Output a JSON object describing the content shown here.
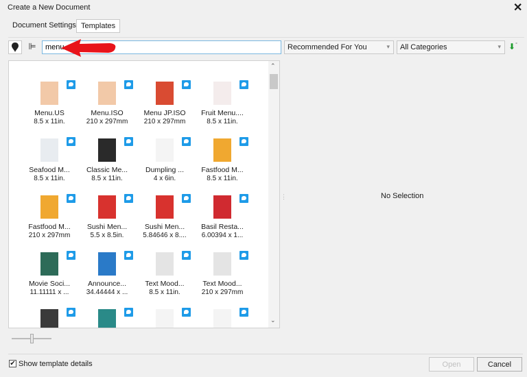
{
  "window": {
    "title": "Create a New Document",
    "close_icon": "close-icon"
  },
  "tabs": [
    {
      "label": "Document Settings"
    },
    {
      "label": "Templates",
      "active": true
    }
  ],
  "toolbar": {
    "search_value": "menu",
    "sort": "Recommended For You",
    "category": "All Categories"
  },
  "templates": [
    {
      "name": "Menu.US",
      "size": "8.5 x 11in.",
      "color": "#f2c9a8"
    },
    {
      "name": "Menu.ISO",
      "size": "210 x 297mm",
      "color": "#f2c9a8"
    },
    {
      "name": "Menu JP.ISO",
      "size": "210 x 297mm",
      "color": "#d94b32"
    },
    {
      "name": "Fruit Menu....",
      "size": "8.5 x 11in.",
      "color": "#f4ecec"
    },
    {
      "name": "Seafood M...",
      "size": "8.5 x 11in.",
      "color": "#e8ecf0"
    },
    {
      "name": "Classic Me...",
      "size": "8.5 x 11in.",
      "color": "#2a2a2a"
    },
    {
      "name": "Dumpling ...",
      "size": "4 x 6in.",
      "color": "#f4f4f4"
    },
    {
      "name": "Fastfood M...",
      "size": "8.5 x 11in.",
      "color": "#f0a830"
    },
    {
      "name": "Fastfood M...",
      "size": "210 x 297mm",
      "color": "#f0a830"
    },
    {
      "name": "Sushi Men...",
      "size": "5.5 x 8.5in.",
      "color": "#d8322e"
    },
    {
      "name": "Sushi Men...",
      "size": "5.84646 x 8....",
      "color": "#d8322e"
    },
    {
      "name": "Basil Resta...",
      "size": "6.00394 x 1...",
      "color": "#d02a30"
    },
    {
      "name": "Movie Soci...",
      "size": "11.11111 x ...",
      "color": "#2d6b58"
    },
    {
      "name": "Announce...",
      "size": "34.44444 x ...",
      "color": "#2a7ac8"
    },
    {
      "name": "Text Mood...",
      "size": "8.5 x 11in.",
      "color": "#e4e4e4"
    },
    {
      "name": "Text Mood...",
      "size": "210 x 297mm",
      "color": "#e4e4e4"
    },
    {
      "name": "",
      "size": "",
      "color": "#3a3a3a"
    },
    {
      "name": "",
      "size": "",
      "color": "#2a8a88"
    },
    {
      "name": "",
      "size": "",
      "color": "#f4f4f4"
    },
    {
      "name": "",
      "size": "",
      "color": "#f4f4f4"
    }
  ],
  "preview": {
    "empty_text": "No Selection"
  },
  "footer": {
    "show_details_label": "Show template details",
    "show_details_checked": true,
    "open_label": "Open",
    "cancel_label": "Cancel"
  },
  "colors": {
    "accent": "#1e9be8",
    "arrow": "#e8141b"
  }
}
